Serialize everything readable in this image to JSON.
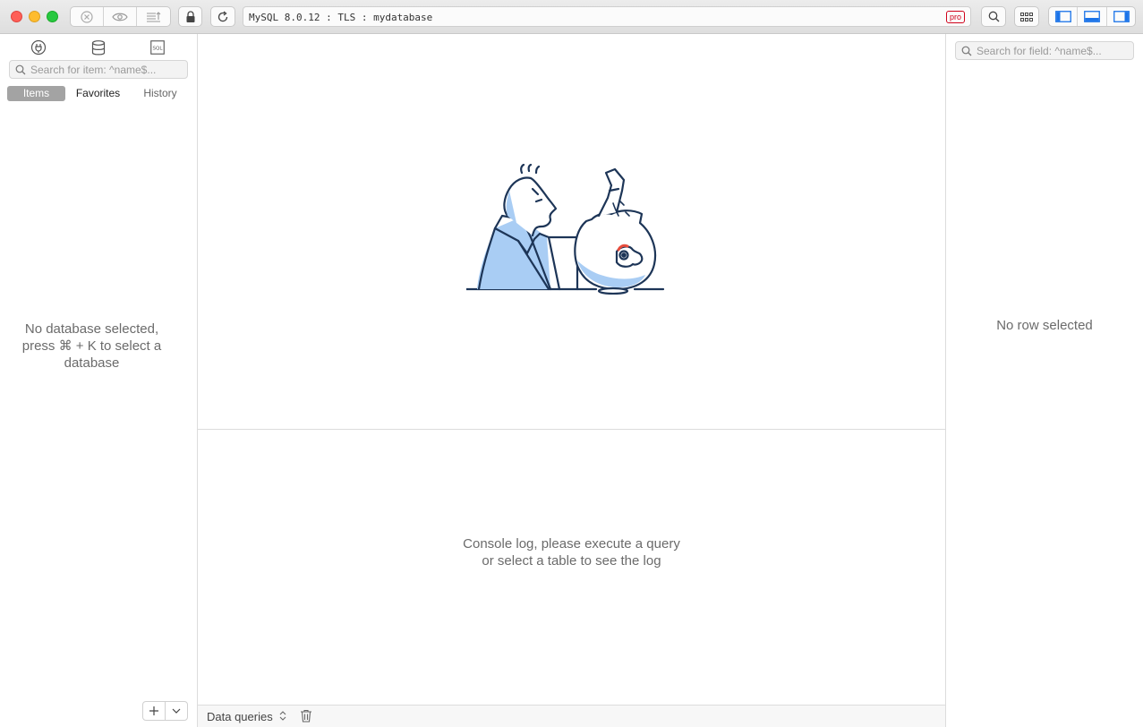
{
  "toolbar": {
    "connection": "MySQL 8.0.12 : TLS : mydatabase",
    "badge": "pro"
  },
  "sidebar": {
    "search_placeholder": "Search for item: ^name$...",
    "tabs": [
      {
        "label": "Items",
        "active": true
      },
      {
        "label": "Favorites",
        "active": false
      },
      {
        "label": "History",
        "active": false
      }
    ],
    "empty_line1": "No database selected,",
    "empty_line2": "press ⌘ + K to select a",
    "empty_line3": "database",
    "footer_add": "+",
    "footer_more": "⌄"
  },
  "main": {
    "console_line1": "Console log, please execute a query",
    "console_line2": "or select a table to see the log",
    "status_label": "Data queries"
  },
  "right_panel": {
    "search_placeholder": "Search for field: ^name$...",
    "empty_text": "No row selected"
  },
  "colors": {
    "accent": "#1a73e8",
    "illustration_fill": "#a9cdf4",
    "illustration_stroke": "#1d3557",
    "pro": "#d0021b"
  }
}
